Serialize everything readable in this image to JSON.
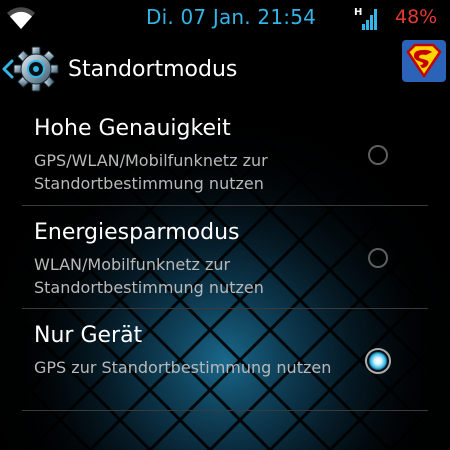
{
  "status_bar": {
    "clock": "Di. 07 Jan. 21:54",
    "network_type": "H",
    "battery": "48%",
    "colors": {
      "clock": "#33b5e5",
      "battery": "#e53935",
      "icons": "#33b5e5"
    }
  },
  "action_bar": {
    "title": "Standortmodus",
    "up_icon": "settings-gear-icon",
    "app_icon": "superman-icon"
  },
  "options": [
    {
      "title": "Hohe Genauigkeit",
      "summary": "GPS/WLAN/Mobilfunknetz zur Standortbestimmung nutzen",
      "selected": false
    },
    {
      "title": "Energiesparmodus",
      "summary": "WLAN/Mobilfunknetz zur Standortbestimmung nutzen",
      "selected": false
    },
    {
      "title": "Nur Gerät",
      "summary": "GPS zur Standortbestimmung nutzen",
      "selected": true
    }
  ]
}
